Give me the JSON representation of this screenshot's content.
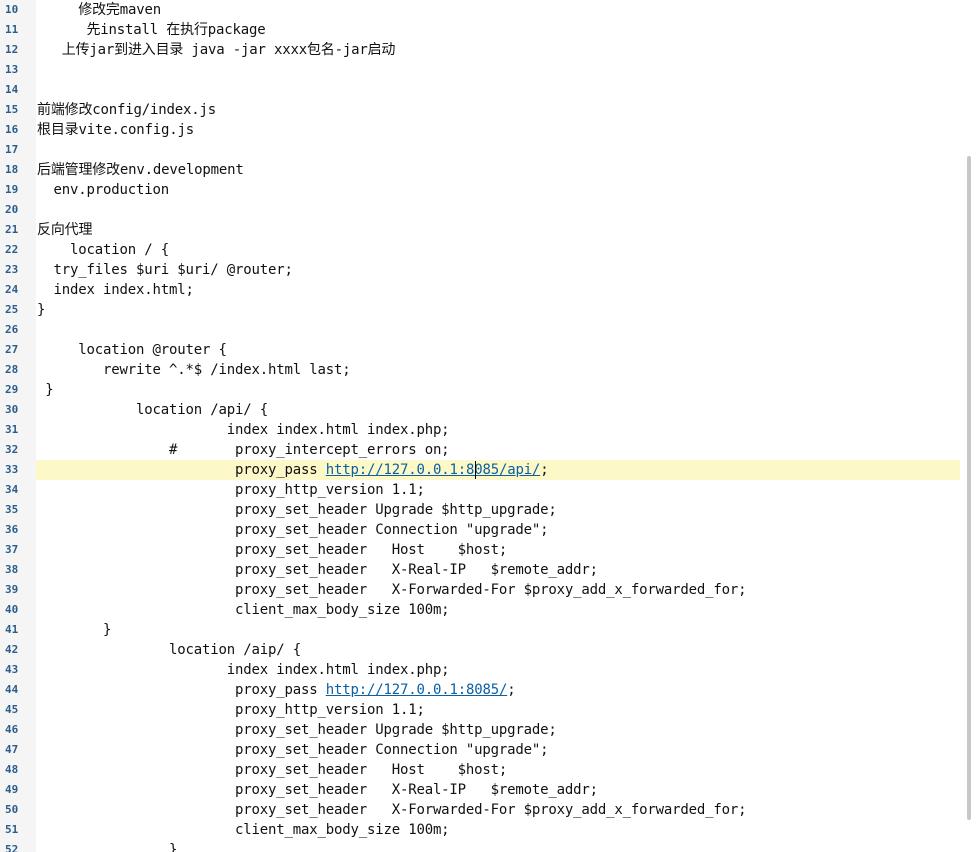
{
  "editor": {
    "current_line": 33,
    "lines": [
      {
        "n": "10",
        "text": "     修改完maven"
      },
      {
        "n": "11",
        "text": "      先install 在执行package"
      },
      {
        "n": "12",
        "text": "   上传jar到进入目录 java -jar xxxx包名-jar启动"
      },
      {
        "n": "13",
        "text": ""
      },
      {
        "n": "14",
        "text": ""
      },
      {
        "n": "15",
        "text": "前端修改config/index.js"
      },
      {
        "n": "16",
        "text": "根目录vite.config.js"
      },
      {
        "n": "17",
        "text": ""
      },
      {
        "n": "18",
        "text": "后端管理修改env.development"
      },
      {
        "n": "19",
        "text": "  env.production"
      },
      {
        "n": "20",
        "text": ""
      },
      {
        "n": "21",
        "text": "反向代理"
      },
      {
        "n": "22",
        "text": "    location / {"
      },
      {
        "n": "23",
        "text": "  try_files $uri $uri/ @router;"
      },
      {
        "n": "24",
        "text": "  index index.html;"
      },
      {
        "n": "25",
        "text": "}"
      },
      {
        "n": "26",
        "text": ""
      },
      {
        "n": "27",
        "text": "     location @router {"
      },
      {
        "n": "28",
        "text": "        rewrite ^.*$ /index.html last;"
      },
      {
        "n": "29",
        "text": " }"
      },
      {
        "n": "30",
        "text": "            location /api/ {"
      },
      {
        "n": "31",
        "text": "                       index index.html index.php;"
      },
      {
        "n": "32",
        "text": "                #       proxy_intercept_errors on;"
      },
      {
        "n": "33",
        "pre": "                        proxy_pass ",
        "link": "http://127.0.0.1:8085/api/",
        "post": ";"
      },
      {
        "n": "34",
        "text": "                        proxy_http_version 1.1;"
      },
      {
        "n": "35",
        "text": "                        proxy_set_header Upgrade $http_upgrade;"
      },
      {
        "n": "36",
        "text": "                        proxy_set_header Connection \"upgrade\";"
      },
      {
        "n": "37",
        "text": "                        proxy_set_header   Host    $host;"
      },
      {
        "n": "38",
        "text": "                        proxy_set_header   X-Real-IP   $remote_addr;"
      },
      {
        "n": "39",
        "text": "                        proxy_set_header   X-Forwarded-For $proxy_add_x_forwarded_for;"
      },
      {
        "n": "40",
        "text": "                        client_max_body_size 100m;"
      },
      {
        "n": "41",
        "text": "        }"
      },
      {
        "n": "42",
        "text": "                location /aip/ {"
      },
      {
        "n": "43",
        "text": "                       index index.html index.php;"
      },
      {
        "n": "44",
        "pre": "                        proxy_pass ",
        "link": "http://127.0.0.1:8085/",
        "post": ";"
      },
      {
        "n": "45",
        "text": "                        proxy_http_version 1.1;"
      },
      {
        "n": "46",
        "text": "                        proxy_set_header Upgrade $http_upgrade;"
      },
      {
        "n": "47",
        "text": "                        proxy_set_header Connection \"upgrade\";"
      },
      {
        "n": "48",
        "text": "                        proxy_set_header   Host    $host;"
      },
      {
        "n": "49",
        "text": "                        proxy_set_header   X-Real-IP   $remote_addr;"
      },
      {
        "n": "50",
        "text": "                        proxy_set_header   X-Forwarded-For $proxy_add_x_forwarded_for;"
      },
      {
        "n": "51",
        "text": "                        client_max_body_size 100m;"
      },
      {
        "n": "52",
        "text": "                }"
      }
    ]
  }
}
